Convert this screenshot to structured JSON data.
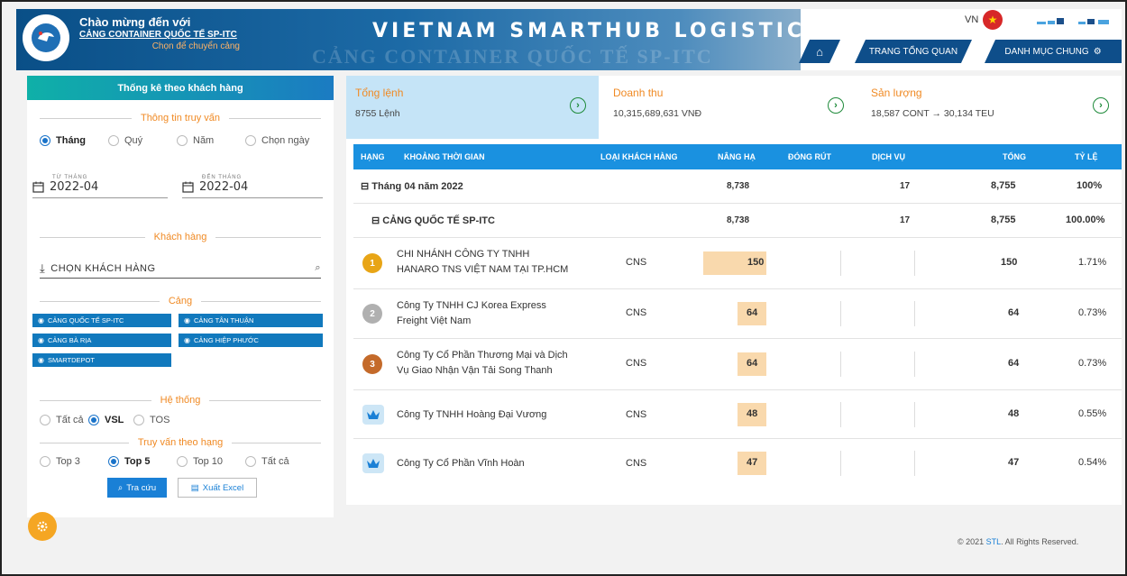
{
  "header": {
    "welcome": "Chào mừng đến với",
    "port_name": "CẢNG CONTAINER QUỐC TẾ SP-ITC",
    "switch_port": "Chọn để chuyển cảng",
    "brand": "VIETNAM SMARTHUB LOGISTICS",
    "watermark": "CẢNG CONTAINER QUỐC TẾ SP-ITC",
    "language": "VN",
    "nav": {
      "overview": "TRANG TỔNG QUAN",
      "catalog": "DANH MỤC CHUNG"
    }
  },
  "sidebar": {
    "title": "Thống kê theo khách hàng",
    "query_info": "Thông tin truy vấn",
    "period_options": [
      "Tháng",
      "Quý",
      "Năm",
      "Chọn ngày"
    ],
    "period_selected": "Tháng",
    "from_label": "TỪ THÁNG",
    "from_value": "2022-04",
    "to_label": "ĐẾN THÁNG",
    "to_value": "2022-04",
    "customer_label": "Khách hàng",
    "customer_placeholder": "CHỌN KHÁCH HÀNG",
    "port_label": "Cảng",
    "ports": [
      "CẢNG QUỐC TẾ SP-ITC",
      "CẢNG TÂN THUẬN",
      "CẢNG BÀ RỊA",
      "CẢNG HIỆP PHƯỚC",
      "SMARTDEPOT"
    ],
    "system_label": "Hệ thống",
    "system_options": [
      "Tất cả",
      "VSL",
      "TOS"
    ],
    "system_selected": "VSL",
    "rank_label": "Truy vấn theo hạng",
    "rank_options": [
      "Top 3",
      "Top 5",
      "Top 10",
      "Tất cả"
    ],
    "rank_selected": "Top 5",
    "search_button": "Tra cứu",
    "excel_button": "Xuất Excel"
  },
  "cards": [
    {
      "title": "Tổng lệnh",
      "value": "8755 Lệnh"
    },
    {
      "title": "Doanh thu",
      "value": "10,315,689,631 VNĐ"
    },
    {
      "title": "Sản lượng",
      "value": "18,587 CONT → 30,134 TEU"
    }
  ],
  "table": {
    "headers": {
      "rank": "HẠNG",
      "period": "KHOẢNG THỜI GIAN",
      "customer_type": "LOẠI KHÁCH HÀNG",
      "lift": "NÂNG HẠ",
      "stuffing": "ĐÓNG RÚT",
      "service": "DỊCH VỤ",
      "total": "TỔNG",
      "ratio": "TỶ LỆ"
    },
    "group": {
      "label": "Tháng 04 năm 2022",
      "lift": "8,738",
      "service": "17",
      "total": "8,755",
      "ratio": "100%"
    },
    "subgroup": {
      "label": "CẢNG QUỐC TẾ SP-ITC",
      "lift": "8,738",
      "service": "17",
      "total": "8,755",
      "ratio": "100.00%"
    },
    "rows": [
      {
        "name1": "CHI NHÁNH CÔNG TY TNHH",
        "name2": "HANARO TNS VIỆT NAM TẠI TP.HCM",
        "type": "CNS",
        "lift": "150",
        "total": "150",
        "ratio": "1.71%"
      },
      {
        "name1": "Công Ty TNHH CJ Korea Express",
        "name2": "Freight Việt Nam",
        "type": "CNS",
        "lift": "64",
        "total": "64",
        "ratio": "0.73%"
      },
      {
        "name1": "Công Ty Cổ Phần Thương Mại và Dịch",
        "name2": "Vụ Giao Nhận Vận Tải Song Thanh",
        "type": "CNS",
        "lift": "64",
        "total": "64",
        "ratio": "0.73%"
      },
      {
        "name1": "Công Ty TNHH Hoàng Đại Vương",
        "type": "CNS",
        "lift": "48",
        "total": "48",
        "ratio": "0.55%"
      },
      {
        "name1": "Công Ty Cổ Phần Vĩnh Hoàn",
        "type": "CNS",
        "lift": "47",
        "total": "47",
        "ratio": "0.54%"
      }
    ],
    "medals": [
      "1",
      "2",
      "3"
    ]
  },
  "footer": {
    "prefix": "© 2021 ",
    "brand": "STL",
    "suffix": ". All Rights Reserved."
  },
  "colors": {
    "primary": "#1a91e0",
    "accent": "#f08a24",
    "highlight": "#f9d9ad",
    "card_active": "#c5e4f7"
  }
}
